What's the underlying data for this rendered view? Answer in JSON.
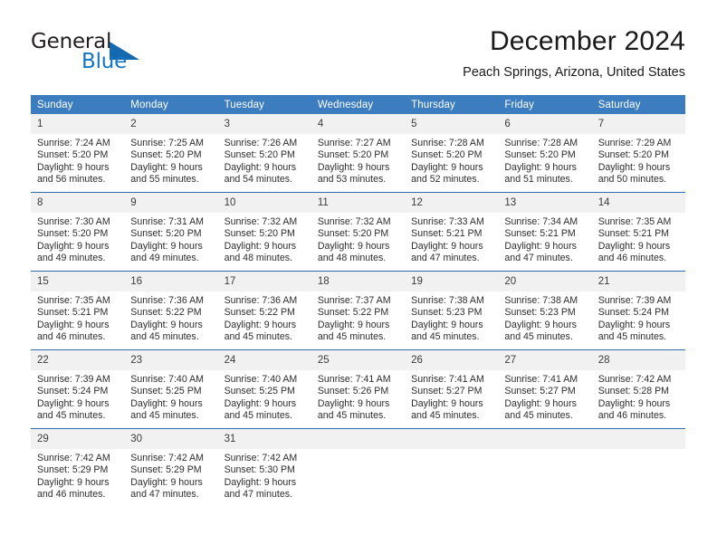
{
  "logo": {
    "primary_text": "General",
    "secondary_text": "Blue",
    "triangle_color": "#1469b0",
    "blue_color": "#1675c0"
  },
  "header": {
    "title": "December 2024",
    "subtitle": "Peach Springs, Arizona, United States"
  },
  "theme": {
    "header_blue": "#3b7dbf",
    "row_rule_blue": "#2f6cad",
    "daynum_background": "#f1f1f1"
  },
  "calendar": {
    "weekday_headers": [
      "Sunday",
      "Monday",
      "Tuesday",
      "Wednesday",
      "Thursday",
      "Friday",
      "Saturday"
    ],
    "weeks": [
      [
        {
          "day": "1",
          "sunrise": "Sunrise: 7:24 AM",
          "sunset": "Sunset: 5:20 PM",
          "daylight": "Daylight: 9 hours and 56 minutes."
        },
        {
          "day": "2",
          "sunrise": "Sunrise: 7:25 AM",
          "sunset": "Sunset: 5:20 PM",
          "daylight": "Daylight: 9 hours and 55 minutes."
        },
        {
          "day": "3",
          "sunrise": "Sunrise: 7:26 AM",
          "sunset": "Sunset: 5:20 PM",
          "daylight": "Daylight: 9 hours and 54 minutes."
        },
        {
          "day": "4",
          "sunrise": "Sunrise: 7:27 AM",
          "sunset": "Sunset: 5:20 PM",
          "daylight": "Daylight: 9 hours and 53 minutes."
        },
        {
          "day": "5",
          "sunrise": "Sunrise: 7:28 AM",
          "sunset": "Sunset: 5:20 PM",
          "daylight": "Daylight: 9 hours and 52 minutes."
        },
        {
          "day": "6",
          "sunrise": "Sunrise: 7:28 AM",
          "sunset": "Sunset: 5:20 PM",
          "daylight": "Daylight: 9 hours and 51 minutes."
        },
        {
          "day": "7",
          "sunrise": "Sunrise: 7:29 AM",
          "sunset": "Sunset: 5:20 PM",
          "daylight": "Daylight: 9 hours and 50 minutes."
        }
      ],
      [
        {
          "day": "8",
          "sunrise": "Sunrise: 7:30 AM",
          "sunset": "Sunset: 5:20 PM",
          "daylight": "Daylight: 9 hours and 49 minutes."
        },
        {
          "day": "9",
          "sunrise": "Sunrise: 7:31 AM",
          "sunset": "Sunset: 5:20 PM",
          "daylight": "Daylight: 9 hours and 49 minutes."
        },
        {
          "day": "10",
          "sunrise": "Sunrise: 7:32 AM",
          "sunset": "Sunset: 5:20 PM",
          "daylight": "Daylight: 9 hours and 48 minutes."
        },
        {
          "day": "11",
          "sunrise": "Sunrise: 7:32 AM",
          "sunset": "Sunset: 5:20 PM",
          "daylight": "Daylight: 9 hours and 48 minutes."
        },
        {
          "day": "12",
          "sunrise": "Sunrise: 7:33 AM",
          "sunset": "Sunset: 5:21 PM",
          "daylight": "Daylight: 9 hours and 47 minutes."
        },
        {
          "day": "13",
          "sunrise": "Sunrise: 7:34 AM",
          "sunset": "Sunset: 5:21 PM",
          "daylight": "Daylight: 9 hours and 47 minutes."
        },
        {
          "day": "14",
          "sunrise": "Sunrise: 7:35 AM",
          "sunset": "Sunset: 5:21 PM",
          "daylight": "Daylight: 9 hours and 46 minutes."
        }
      ],
      [
        {
          "day": "15",
          "sunrise": "Sunrise: 7:35 AM",
          "sunset": "Sunset: 5:21 PM",
          "daylight": "Daylight: 9 hours and 46 minutes."
        },
        {
          "day": "16",
          "sunrise": "Sunrise: 7:36 AM",
          "sunset": "Sunset: 5:22 PM",
          "daylight": "Daylight: 9 hours and 45 minutes."
        },
        {
          "day": "17",
          "sunrise": "Sunrise: 7:36 AM",
          "sunset": "Sunset: 5:22 PM",
          "daylight": "Daylight: 9 hours and 45 minutes."
        },
        {
          "day": "18",
          "sunrise": "Sunrise: 7:37 AM",
          "sunset": "Sunset: 5:22 PM",
          "daylight": "Daylight: 9 hours and 45 minutes."
        },
        {
          "day": "19",
          "sunrise": "Sunrise: 7:38 AM",
          "sunset": "Sunset: 5:23 PM",
          "daylight": "Daylight: 9 hours and 45 minutes."
        },
        {
          "day": "20",
          "sunrise": "Sunrise: 7:38 AM",
          "sunset": "Sunset: 5:23 PM",
          "daylight": "Daylight: 9 hours and 45 minutes."
        },
        {
          "day": "21",
          "sunrise": "Sunrise: 7:39 AM",
          "sunset": "Sunset: 5:24 PM",
          "daylight": "Daylight: 9 hours and 45 minutes."
        }
      ],
      [
        {
          "day": "22",
          "sunrise": "Sunrise: 7:39 AM",
          "sunset": "Sunset: 5:24 PM",
          "daylight": "Daylight: 9 hours and 45 minutes."
        },
        {
          "day": "23",
          "sunrise": "Sunrise: 7:40 AM",
          "sunset": "Sunset: 5:25 PM",
          "daylight": "Daylight: 9 hours and 45 minutes."
        },
        {
          "day": "24",
          "sunrise": "Sunrise: 7:40 AM",
          "sunset": "Sunset: 5:25 PM",
          "daylight": "Daylight: 9 hours and 45 minutes."
        },
        {
          "day": "25",
          "sunrise": "Sunrise: 7:41 AM",
          "sunset": "Sunset: 5:26 PM",
          "daylight": "Daylight: 9 hours and 45 minutes."
        },
        {
          "day": "26",
          "sunrise": "Sunrise: 7:41 AM",
          "sunset": "Sunset: 5:27 PM",
          "daylight": "Daylight: 9 hours and 45 minutes."
        },
        {
          "day": "27",
          "sunrise": "Sunrise: 7:41 AM",
          "sunset": "Sunset: 5:27 PM",
          "daylight": "Daylight: 9 hours and 45 minutes."
        },
        {
          "day": "28",
          "sunrise": "Sunrise: 7:42 AM",
          "sunset": "Sunset: 5:28 PM",
          "daylight": "Daylight: 9 hours and 46 minutes."
        }
      ],
      [
        {
          "day": "29",
          "sunrise": "Sunrise: 7:42 AM",
          "sunset": "Sunset: 5:29 PM",
          "daylight": "Daylight: 9 hours and 46 minutes."
        },
        {
          "day": "30",
          "sunrise": "Sunrise: 7:42 AM",
          "sunset": "Sunset: 5:29 PM",
          "daylight": "Daylight: 9 hours and 47 minutes."
        },
        {
          "day": "31",
          "sunrise": "Sunrise: 7:42 AM",
          "sunset": "Sunset: 5:30 PM",
          "daylight": "Daylight: 9 hours and 47 minutes."
        },
        {
          "day": "",
          "sunrise": "",
          "sunset": "",
          "daylight": ""
        },
        {
          "day": "",
          "sunrise": "",
          "sunset": "",
          "daylight": ""
        },
        {
          "day": "",
          "sunrise": "",
          "sunset": "",
          "daylight": ""
        },
        {
          "day": "",
          "sunrise": "",
          "sunset": "",
          "daylight": ""
        }
      ]
    ]
  }
}
